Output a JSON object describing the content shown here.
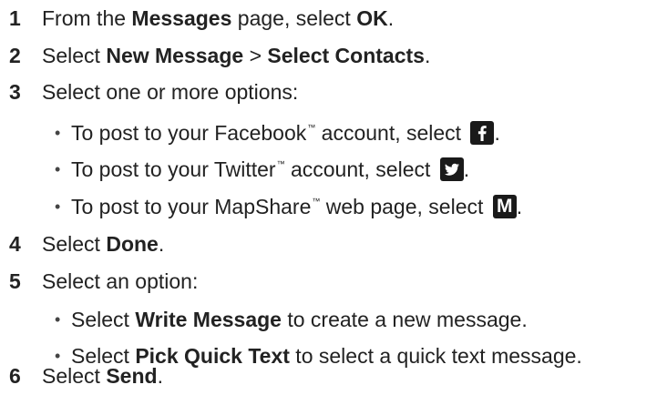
{
  "steps": [
    {
      "num": "1",
      "pre": "From the ",
      "b1": "Messages",
      "mid": " page, select ",
      "b2": "OK",
      "post": "."
    },
    {
      "num": "2",
      "pre": "Select ",
      "b1": "New Message",
      "mid": " > ",
      "b2": "Select Contacts",
      "post": "."
    },
    {
      "num": "3",
      "text": "Select one or more options:"
    },
    {
      "num": "4",
      "pre": "Select ",
      "b1": "Done",
      "post": "."
    },
    {
      "num": "5",
      "text": "Select an option:"
    },
    {
      "num": "6",
      "pre": "Select ",
      "b1": "Send",
      "post": "."
    }
  ],
  "step3_bullets": [
    {
      "pre": "To post to your Facebook",
      "tm": "™",
      "post": " account, select ",
      "end": ".",
      "icon": "facebook-icon"
    },
    {
      "pre": "To post to your Twitter",
      "tm": "™",
      "post": " account, select ",
      "end": ".",
      "icon": "twitter-icon"
    },
    {
      "pre": "To post to your MapShare",
      "tm": "™",
      "post": " web page, select ",
      "end": ".",
      "icon": "mapshare-icon",
      "icon_letter": "M"
    }
  ],
  "step5_bullets": [
    {
      "pre": "Select ",
      "b": "Write Message",
      "post": " to create a new message."
    },
    {
      "pre": "Select ",
      "b": "Pick Quick Text",
      "post": " to select a quick text message."
    }
  ],
  "bullet_char": "•"
}
